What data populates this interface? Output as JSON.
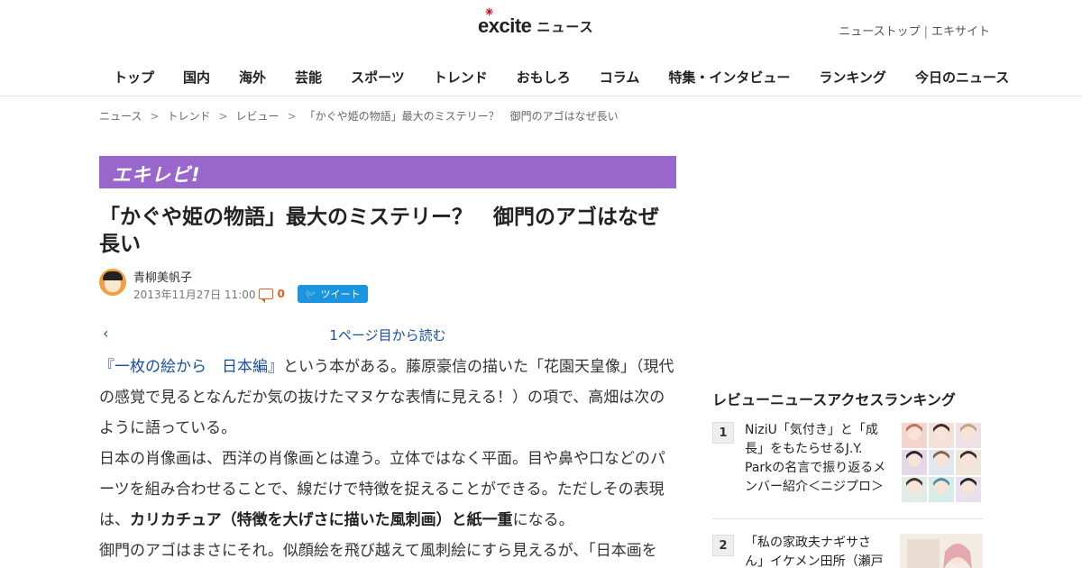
{
  "header": {
    "logo_brand": "excite",
    "logo_section": "ニュース",
    "top_links": [
      "ニューストップ",
      "エキサイト"
    ],
    "top_links_sep": "|"
  },
  "nav": [
    "トップ",
    "国内",
    "海外",
    "芸能",
    "スポーツ",
    "トレンド",
    "おもしろ",
    "コラム",
    "特集・インタビュー",
    "ランキング",
    "今日のニュース"
  ],
  "breadcrumb": {
    "items": [
      "ニュース",
      "トレンド",
      "レビュー",
      "「かぐや姫の物語」最大のミステリー？　御門のアゴはなぜ長い"
    ],
    "sep": ">"
  },
  "article": {
    "banner": "エキレビ!",
    "title": "「かぐや姫の物語」最大のミステリー？　御門のアゴはなぜ長い",
    "author": "青柳美帆子",
    "date": "2013年11月27日 11:00",
    "comment_count": "0",
    "tweet_label": "ツイート",
    "prev_symbol": "‹",
    "page_link": "1ページ目から読む",
    "p1_link": "『一枚の絵から　日本編』",
    "p1_rest": "という本がある。藤原豪信の描いた「花園天皇像」（現代の感覚で見るとなんだか気の抜けたマヌケな表情に見える！）の項で、高畑は次のように語っている。",
    "p2_start": "日本の肖像画は、西洋の肖像画とは違う。立体ではなく平面。目や鼻や口などのパーツを組み合わせることで、線だけで特徴を捉えることができる。ただしその表現は、",
    "p2_bold": "カリカチュア（特徴を大げさに描いた風刺画）と紙一重",
    "p2_end": "になる。",
    "p3": "御門のアゴはまさにそれ。似顔絵を飛び越えて風刺絵にすら見えるが、「日本画を"
  },
  "sidebar": {
    "ranking_title": "レビューニュースアクセスランキング",
    "items": [
      {
        "rank": "1",
        "text": "NiziU「気付き」と「成長」をもたらせるJ.Y. Parkの名言で振り返るメンバー紹介＜ニジプロ＞"
      },
      {
        "rank": "2",
        "text": "「私の家政夫ナギサさん」イケメン田所（瀬戸"
      }
    ]
  },
  "colors": {
    "banner_bg": "#9966cc",
    "link": "#1a4ea0",
    "comment_accent": "#e0611a",
    "tweet_bg": "#1b95e0",
    "logo_accent": "#d0021b"
  }
}
